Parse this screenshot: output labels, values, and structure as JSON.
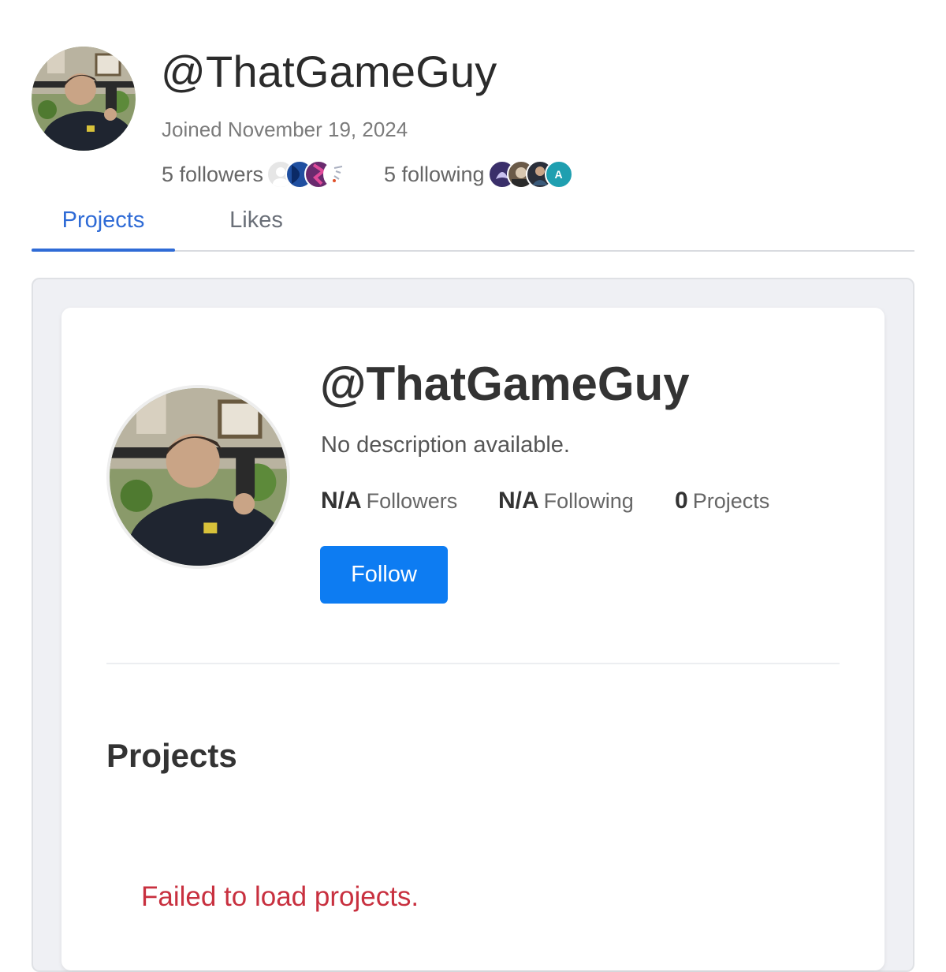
{
  "profile": {
    "handle": "@ThatGameGuy",
    "joined": "Joined November 19, 2024",
    "followers_label": "5 followers",
    "following_label": "5 following",
    "avatar_icon": "user-photo-avatar"
  },
  "tabs": [
    {
      "label": "Projects",
      "active": true
    },
    {
      "label": "Likes",
      "active": false
    }
  ],
  "card": {
    "handle": "@ThatGameGuy",
    "description": "No description available.",
    "followers_count": "N/A",
    "followers_label": "Followers",
    "following_count": "N/A",
    "following_label": "Following",
    "projects_count": "0",
    "projects_label": "Projects",
    "follow_button": "Follow"
  },
  "projects": {
    "heading": "Projects",
    "error": "Failed to load projects."
  },
  "colors": {
    "accent": "#2f6bd6",
    "follow_button": "#0d7cf2",
    "error": "#c8303f",
    "panel_bg": "#eff0f4"
  }
}
